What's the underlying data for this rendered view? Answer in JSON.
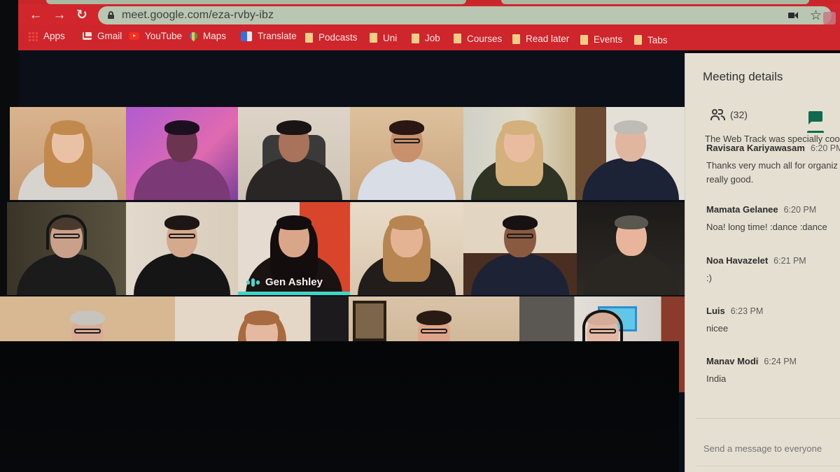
{
  "browser": {
    "url": "meet.google.com/eza-rvby-ibz",
    "nav": {
      "back": "←",
      "forward": "→",
      "reload": "↻"
    },
    "icons": {
      "lock": "lock-icon",
      "camera": "camera-icon",
      "star": "☆"
    },
    "bookmarks": [
      {
        "label": "Apps",
        "icon": "apps-icon"
      },
      {
        "label": "Gmail",
        "icon": "gmail-icon"
      },
      {
        "label": "YouTube",
        "icon": "youtube-icon"
      },
      {
        "label": "Maps",
        "icon": "maps-icon"
      },
      {
        "label": "Translate",
        "icon": "translate-icon"
      },
      {
        "label": "Podcasts",
        "icon": "folder-icon"
      },
      {
        "label": "Uni",
        "icon": "folder-icon"
      },
      {
        "label": "Job",
        "icon": "folder-icon"
      },
      {
        "label": "Courses",
        "icon": "folder-icon"
      },
      {
        "label": "Read later",
        "icon": "folder-icon"
      },
      {
        "label": "Events",
        "icon": "folder-icon"
      },
      {
        "label": "Tabs",
        "icon": "folder-icon"
      }
    ]
  },
  "meeting": {
    "active_speaker": "Gen Ashley",
    "accent_color": "#3fd6c6",
    "tiles_per_row": [
      6,
      6,
      4
    ]
  },
  "panel": {
    "title": "Meeting details",
    "people_count": "(32)",
    "truncated_message": "The Web Track was specially coo",
    "messages": [
      {
        "sender": "Ravisara Kariyawasam",
        "time": "6:20 PM",
        "lines": [
          "Thanks very much all for organiz",
          "really good."
        ]
      },
      {
        "sender": "Mamata Gelanee",
        "time": "6:20 PM",
        "lines": [
          "Noa! long time! :dance :dance"
        ]
      },
      {
        "sender": "Noa Havazelet",
        "time": "6:21 PM",
        "lines": [
          ":)"
        ]
      },
      {
        "sender": "Luis",
        "time": "6:23 PM",
        "lines": [
          "nicee"
        ]
      },
      {
        "sender": "Manav Modi",
        "time": "6:24 PM",
        "lines": [
          "India"
        ]
      }
    ],
    "composer_placeholder": "Send a message to everyone"
  }
}
